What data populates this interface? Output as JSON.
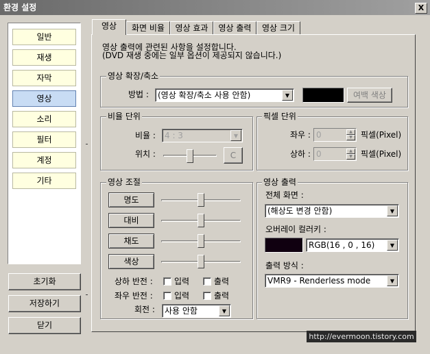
{
  "window": {
    "title": "환경 설정",
    "close_label": "X"
  },
  "sidebar": {
    "items": [
      {
        "label": "일반"
      },
      {
        "label": "재생"
      },
      {
        "label": "자막"
      },
      {
        "label": "영상"
      },
      {
        "label": "소리"
      },
      {
        "label": "필터"
      },
      {
        "label": "계정"
      },
      {
        "label": "기타"
      }
    ],
    "reset_label": "초기화",
    "save_label": "저장하기",
    "close_label": "닫기"
  },
  "tabs": [
    {
      "label": "영상"
    },
    {
      "label": "화면 비율"
    },
    {
      "label": "영상 효과"
    },
    {
      "label": "영상 출력"
    },
    {
      "label": "영상 크기"
    }
  ],
  "description": {
    "line1": "영상 출력에 관련된 사항을 설정합니다.",
    "line2": "(DVD 재생 중에는 일부 옵션이 제공되지 않습니다.)"
  },
  "scale_group": {
    "title": "영상 확장/축소",
    "method_label": "방법 :",
    "method_value": "(영상 확장/축소 사용 안함)",
    "margin_color_label": "여백 색상",
    "swatch_color": "#000000"
  },
  "ratio_group": {
    "title": "비율 단위",
    "ratio_label": "비율 :",
    "ratio_value": "4 : 3",
    "position_label": "위치 :",
    "center_label": "C"
  },
  "pixel_group": {
    "title": "픽셀 단위",
    "lr_label": "좌우 :",
    "lr_value": "0",
    "lr_unit": "픽셀(Pixel)",
    "ud_label": "상하 :",
    "ud_value": "0",
    "ud_unit": "픽셀(Pixel)"
  },
  "adjust_group": {
    "title": "영상 조절",
    "brightness_label": "명도",
    "contrast_label": "대비",
    "saturation_label": "채도",
    "hue_label": "색상",
    "flip_v_label": "상하 반전 :",
    "flip_h_label": "좌우 반전 :",
    "input_label": "입력",
    "output_label": "출력",
    "rotate_label": "회전 :",
    "rotate_value": "사용 안함"
  },
  "output_group": {
    "title": "영상 출력",
    "fullscreen_label": "전체 화면 :",
    "fullscreen_value": "(해상도 변경 안함)",
    "overlay_label": "오버레이 컬러키 :",
    "overlay_value": "RGB(16 , 0 , 16)",
    "overlay_color": "#100010",
    "method_label": "출력 방식 :",
    "method_value": "VMR9 - Renderless mode"
  },
  "watermark": "http://evermoon.tistory.com"
}
